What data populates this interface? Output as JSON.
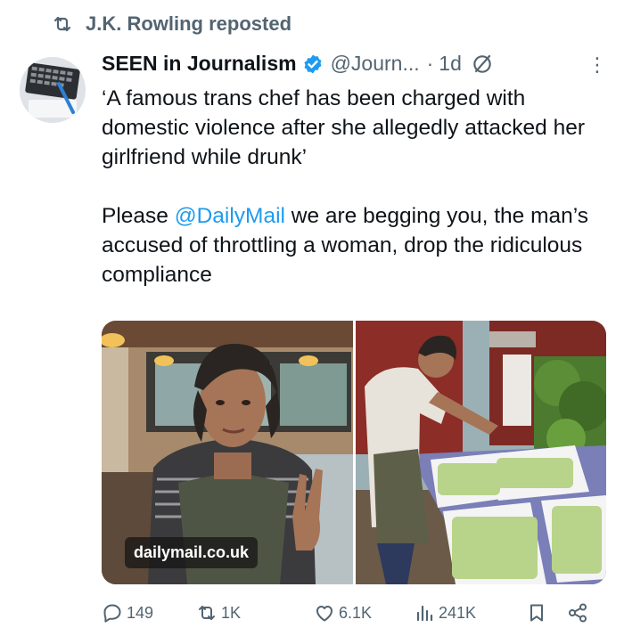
{
  "repost": {
    "label": "J.K. Rowling reposted"
  },
  "author": {
    "name": "SEEN in Journalism",
    "handle": "@Journ...",
    "separator": "·",
    "time": "1d",
    "more": "⋮"
  },
  "tweet": {
    "quote": "‘A famous trans chef has been charged with domestic violence after she allegedly attacked her girlfriend while drunk’",
    "body_before": "Please ",
    "mention": "@DailyMail",
    "body_after": " we are begging you, the man’s accused of throttling a woman, drop the ridiculous compliance"
  },
  "media": {
    "watermark": "dailymail.co.uk"
  },
  "actions": {
    "replies": "149",
    "reposts": "1K",
    "likes": "6.1K",
    "views": "241K"
  },
  "colors": {
    "accent": "#1d9bf0",
    "muted": "#536471",
    "text": "#0f1419"
  },
  "icons": [
    "repost-icon",
    "verified-badge-icon",
    "grok-icon",
    "more-icon",
    "reply-icon",
    "like-icon",
    "views-icon",
    "bookmark-icon",
    "share-icon"
  ]
}
